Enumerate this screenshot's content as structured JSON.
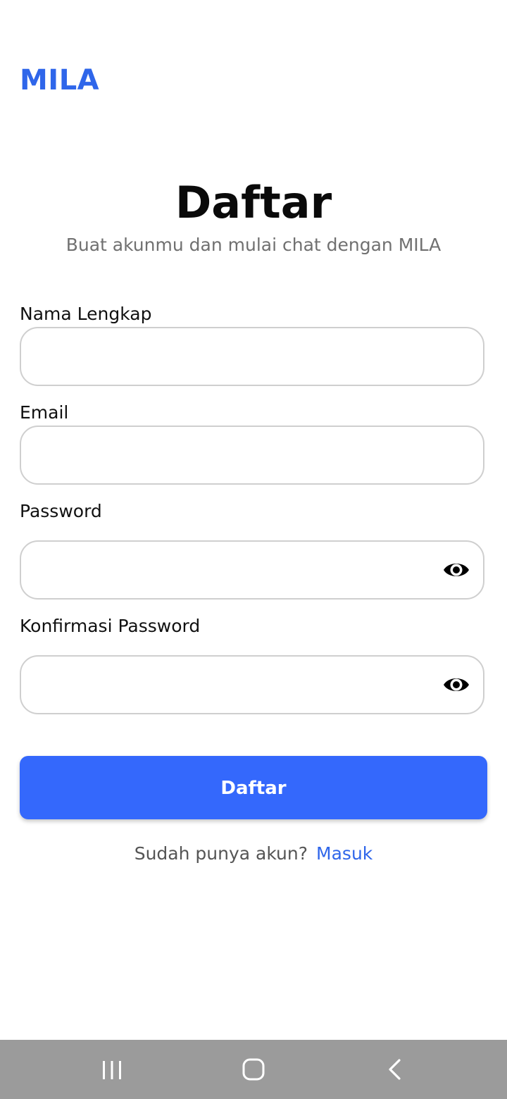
{
  "app": {
    "brand": "MILA"
  },
  "header": {
    "title": "Daftar",
    "subtitle": "Buat akunmu dan mulai chat dengan MILA"
  },
  "form": {
    "full_name": {
      "label": "Nama Lengkap",
      "value": "",
      "placeholder": ""
    },
    "email": {
      "label": "Email",
      "value": "",
      "placeholder": ""
    },
    "password": {
      "label": "Password",
      "value": "",
      "placeholder": "",
      "toggle_icon": "eye-icon"
    },
    "confirm_password": {
      "label": "Konfirmasi Password",
      "value": "",
      "placeholder": "",
      "toggle_icon": "eye-icon"
    },
    "submit_label": "Daftar"
  },
  "footer": {
    "prompt": "Sudah punya akun?",
    "link_label": "Masuk"
  },
  "system_nav": {
    "recents_icon": "recents-icon",
    "home_icon": "home-icon",
    "back_icon": "back-icon"
  },
  "colors": {
    "accent": "#2f66ea",
    "button": "#3468fc",
    "navbar": "#9b9b9b"
  }
}
